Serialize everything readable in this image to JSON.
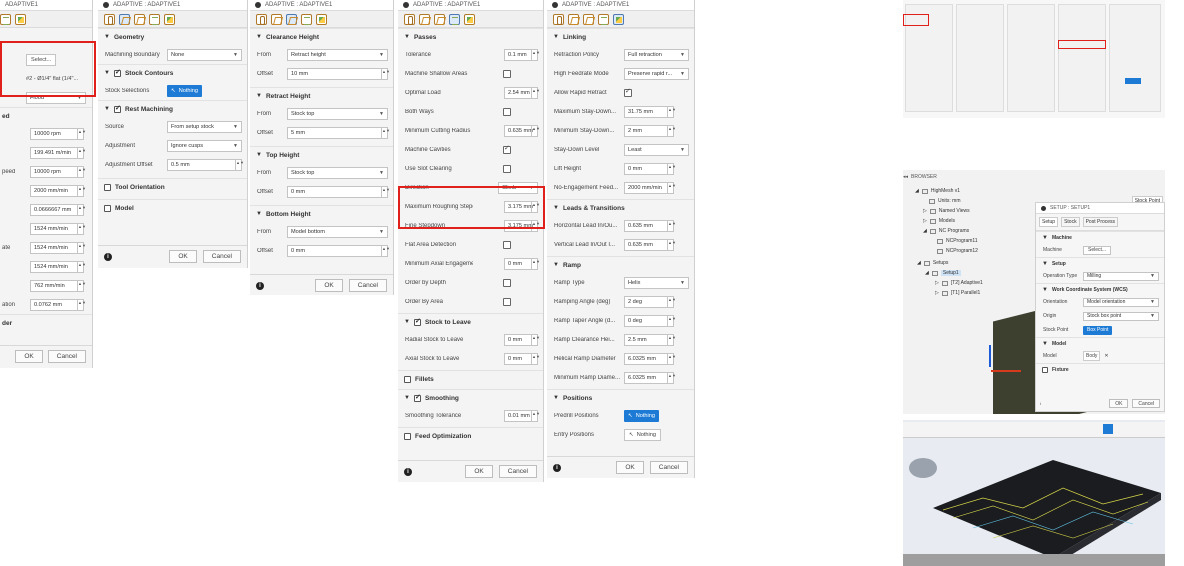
{
  "dialog_title": "ADAPTIVE : ADAPTIVE1",
  "dialog_title_short": "ADAPTIVE1",
  "footer": {
    "ok": "OK",
    "cancel": "Cancel"
  },
  "panel1": {
    "select_btn": "Select...",
    "tool_name": "#2 - Ø1/4\" flat (1/4\"...",
    "coolant": "Flood",
    "section_fragment": "ed",
    "values": [
      "10000 rpm",
      "199.491 m/min",
      "10000 rpm",
      "2000 mm/min",
      "0.0666667 mm",
      "1524 mm/min",
      "1524 mm/min",
      "1524 mm/min",
      "762 mm/min",
      "0.0762 mm"
    ],
    "label_fragments": [
      "",
      "",
      "peed",
      "",
      "",
      "",
      "ate",
      "",
      "",
      "ation"
    ],
    "last_section": "der"
  },
  "panel2": {
    "geometry": "Geometry",
    "machining_boundary_label": "Machining Boundary",
    "machining_boundary_value": "None",
    "stock_contours": "Stock Contours",
    "stock_selections_label": "Stock Selections",
    "nothing": "Nothing",
    "rest_machining": "Rest Machining",
    "source_label": "Source",
    "source_value": "From setup stock",
    "adjustment_label": "Adjustment",
    "adjustment_value": "Ignore cusps",
    "adjustment_offset_label": "Adjustment Offset",
    "adjustment_offset_value": "0.5 mm",
    "tool_orientation": "Tool Orientation",
    "model": "Model"
  },
  "panel3": {
    "clearance_height": "Clearance Height",
    "from": "From",
    "offset": "Offset",
    "clearance_from": "Retract height",
    "clearance_offset": "10 mm",
    "retract_height": "Retract Height",
    "retract_from": "Stock top",
    "retract_offset": "5 mm",
    "top_height": "Top Height",
    "top_from": "Stock top",
    "top_offset": "0 mm",
    "bottom_height": "Bottom Height",
    "bottom_from": "Model bottom",
    "bottom_offset": "0 mm"
  },
  "panel4": {
    "passes": "Passes",
    "tolerance_label": "Tolerance",
    "tolerance": "0.1 mm",
    "machine_shallow_label": "Machine Shallow Areas",
    "optimal_load_label": "Optimal Load",
    "optimal_load": "2.54 mm",
    "both_ways_label": "Both Ways",
    "min_cutting_radius_label": "Minimum Cutting Radius",
    "min_cutting_radius": "0.635 mm",
    "machine_cavities_label": "Machine Cavities",
    "use_slot_clearing_label": "Use Slot Clearing",
    "direction_label": "Direction",
    "direction": "Climb",
    "max_roughing_label": "Maximum Roughing Stepdov...",
    "max_roughing": "3.175 mm",
    "fine_stepdown_label": "Fine Stepdown",
    "fine_stepdown": "3.175 mm",
    "flat_area_label": "Flat Area Detection",
    "min_axial_label": "Minimum Axial Engagement",
    "min_axial": "0 mm",
    "order_by_depth_label": "Order by Depth",
    "order_by_area_label": "Order By Area",
    "stock_to_leave": "Stock to Leave",
    "radial_label": "Radial Stock to Leave",
    "radial": "0 mm",
    "axial_label": "Axial Stock to Leave",
    "axial": "0 mm",
    "fillets": "Fillets",
    "smoothing": "Smoothing",
    "smoothing_tol_label": "Smoothing Tolerance",
    "smoothing_tol": "0.01 mm",
    "feed_opt": "Feed Optimization"
  },
  "panel5": {
    "linking": "Linking",
    "retraction_policy_label": "Retraction Policy",
    "retraction_policy": "Full retraction",
    "high_feed_label": "High Feedrate Mode",
    "high_feed": "Preserve rapid r...",
    "allow_rapid_label": "Allow Rapid Retract",
    "max_staydown_label": "Maximum Stay-Down...",
    "max_staydown": "31.75 mm",
    "min_staydown_label": "Minimum Stay-Down...",
    "min_staydown": "2 mm",
    "staydown_level_label": "Stay-Down Level",
    "staydown_level": "Least",
    "lift_height_label": "Lift Height",
    "lift_height": "0 mm",
    "no_engagement_label": "No-Engagement Feed...",
    "no_engagement": "2000 mm/min",
    "leads": "Leads & Transitions",
    "horiz_lead_label": "Horizontal Lead In/Ou...",
    "horiz_lead": "0.635 mm",
    "vert_lead_label": "Vertical Lead In/Out I...",
    "vert_lead": "0.635 mm",
    "ramp": "Ramp",
    "ramp_type_label": "Ramp Type",
    "ramp_type": "Helix",
    "ramp_angle_label": "Ramping Angle (deg)",
    "ramp_angle": "2 deg",
    "ramp_taper_label": "Ramp Taper Angle (d...",
    "ramp_taper": "0 deg",
    "ramp_clear_label": "Ramp Clearance Hei...",
    "ramp_clear": "2.5 mm",
    "helical_dia_label": "Helical Ramp Diameter",
    "helical_dia": "6.0325 mm",
    "min_ramp_dia_label": "Minimum Ramp Diame...",
    "min_ramp_dia": "6.0325 mm",
    "positions": "Positions",
    "predrill_label": "Predrill Positions",
    "nothing": "Nothing",
    "entry_label": "Entry Positions",
    "entry_value": "Nothing"
  },
  "browser": {
    "title": "BROWSER",
    "root": "HighMesh v1",
    "units": "Units: mm",
    "named_views": "Named Views",
    "models": "Models",
    "nc_programs": "NC Programs",
    "nc1": "NCProgram11",
    "nc2": "NCProgram12",
    "setups": "Setups",
    "setup1": "Setup1",
    "op1": "[T2] Adaptive1",
    "op2": "[T1] Parallel1",
    "stock_point_tag": "Stock Point",
    "setup_title": "SETUP : SETUP1",
    "setup_tab": "Setup",
    "stock_tab": "Stock",
    "post_tab": "Post Process",
    "machine_sect": "Machine",
    "machine_label": "Machine",
    "machine_btn": "Select...",
    "setup_sect": "Setup",
    "op_type_label": "Operation Type",
    "op_type": "Milling",
    "wcs_sect": "Work Coordinate System (WCS)",
    "orientation_label": "Orientation",
    "orientation": "Model orientation",
    "origin_label": "Origin",
    "origin": "Stock box point",
    "stock_point_label": "Stock Point",
    "stock_point_btn": "Box Point",
    "model_sect": "Model",
    "model_label": "Model",
    "model_value": "Body",
    "fixture": "Fixture",
    "ok": "OK",
    "cancel": "Cancel"
  },
  "colors": {
    "highlight": "#e0201a",
    "accent": "#1d7bd6"
  }
}
